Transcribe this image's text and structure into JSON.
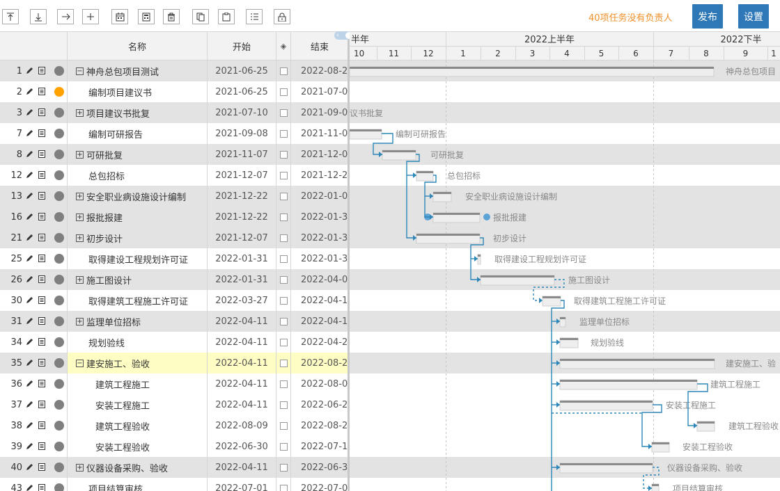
{
  "toolbar": {
    "buttons": [
      {
        "name": "move-top-button",
        "icon": "arrow-top-icon"
      },
      {
        "name": "move-bottom-button",
        "icon": "arrow-bottom-icon"
      },
      {
        "name": "indent-button",
        "icon": "arrow-right-icon"
      },
      {
        "name": "add-button",
        "icon": "plus-icon"
      },
      {
        "name": "calendar-button",
        "icon": "calendar-icon"
      },
      {
        "name": "calculator-button",
        "icon": "calculator-icon"
      },
      {
        "name": "delete-button",
        "icon": "trash-icon"
      },
      {
        "name": "copy-button",
        "icon": "copy-icon"
      },
      {
        "name": "paste-button",
        "icon": "clipboard-icon"
      },
      {
        "name": "checklist-button",
        "icon": "checklist-icon"
      },
      {
        "name": "lock-button",
        "icon": "lock-icon"
      }
    ],
    "warning": "40项任务没有负责人",
    "publish_label": "发布",
    "settings_label": "设置"
  },
  "grid": {
    "headers": {
      "name": "名称",
      "start": "开始",
      "milestone_icon": "◈",
      "end": "结束"
    },
    "rows": [
      {
        "idx": "1",
        "name": "神舟总包项目测试",
        "start": "2021-06-25",
        "end": "2022-08-2",
        "expander": "−",
        "indent": 0,
        "dot": "gray",
        "shade": true
      },
      {
        "idx": "2",
        "name": "编制项目建议书",
        "start": "2021-06-25",
        "end": "2021-07-0",
        "expander": "",
        "indent": 1,
        "dot": "orange",
        "shade": false
      },
      {
        "idx": "3",
        "name": "项目建议书批复",
        "start": "2021-07-10",
        "end": "2021-09-0",
        "expander": "+",
        "indent": 0,
        "dot": "gray",
        "shade": true
      },
      {
        "idx": "7",
        "name": "编制可研报告",
        "start": "2021-09-08",
        "end": "2021-11-0",
        "expander": "",
        "indent": 1,
        "dot": "gray",
        "shade": false
      },
      {
        "idx": "8",
        "name": "可研批复",
        "start": "2021-11-07",
        "end": "2021-12-0",
        "expander": "+",
        "indent": 0,
        "dot": "gray",
        "shade": true
      },
      {
        "idx": "12",
        "name": "总包招标",
        "start": "2021-12-07",
        "end": "2021-12-2",
        "expander": "",
        "indent": 1,
        "dot": "gray",
        "shade": false
      },
      {
        "idx": "13",
        "name": "安全职业病设施设计编制",
        "start": "2021-12-22",
        "end": "2022-01-0",
        "expander": "+",
        "indent": 0,
        "dot": "gray",
        "shade": true
      },
      {
        "idx": "16",
        "name": "报批报建",
        "start": "2021-12-22",
        "end": "2022-01-3",
        "expander": "+",
        "indent": 0,
        "dot": "gray",
        "shade": true
      },
      {
        "idx": "21",
        "name": "初步设计",
        "start": "2021-12-07",
        "end": "2022-01-3",
        "expander": "+",
        "indent": 0,
        "dot": "gray",
        "shade": true
      },
      {
        "idx": "25",
        "name": "取得建设工程规划许可证",
        "start": "2022-01-31",
        "end": "2022-01-3",
        "expander": "",
        "indent": 1,
        "dot": "gray",
        "shade": false
      },
      {
        "idx": "26",
        "name": "施工图设计",
        "start": "2022-01-31",
        "end": "2022-04-0",
        "expander": "+",
        "indent": 0,
        "dot": "gray",
        "shade": true
      },
      {
        "idx": "30",
        "name": "取得建筑工程施工许可证",
        "start": "2022-03-27",
        "end": "2022-04-1",
        "expander": "",
        "indent": 1,
        "dot": "gray",
        "shade": false
      },
      {
        "idx": "31",
        "name": "监理单位招标",
        "start": "2022-04-11",
        "end": "2022-04-1",
        "expander": "+",
        "indent": 0,
        "dot": "gray",
        "shade": true
      },
      {
        "idx": "34",
        "name": "规划验线",
        "start": "2022-04-11",
        "end": "2022-04-2",
        "expander": "",
        "indent": 1,
        "dot": "gray",
        "shade": false
      },
      {
        "idx": "35",
        "name": "建安施工、验收",
        "start": "2022-04-11",
        "end": "2022-08-2",
        "expander": "−",
        "indent": 0,
        "dot": "gray",
        "shade": true,
        "highlight": true
      },
      {
        "idx": "36",
        "name": "建筑工程施工",
        "start": "2022-04-11",
        "end": "2022-08-0",
        "expander": "",
        "indent": 2,
        "dot": "gray",
        "shade": false
      },
      {
        "idx": "37",
        "name": "安装工程施工",
        "start": "2022-04-11",
        "end": "2022-06-2",
        "expander": "",
        "indent": 2,
        "dot": "gray",
        "shade": false
      },
      {
        "idx": "38",
        "name": "建筑工程验收",
        "start": "2022-08-09",
        "end": "2022-08-2",
        "expander": "",
        "indent": 2,
        "dot": "gray",
        "shade": false
      },
      {
        "idx": "39",
        "name": "安装工程验收",
        "start": "2022-06-30",
        "end": "2022-07-1",
        "expander": "",
        "indent": 2,
        "dot": "gray",
        "shade": false
      },
      {
        "idx": "40",
        "name": "仪器设备采购、验收",
        "start": "2022-04-11",
        "end": "2022-06-3",
        "expander": "+",
        "indent": 0,
        "dot": "gray",
        "shade": true
      },
      {
        "idx": "43",
        "name": "项目结算审核",
        "start": "2022-07-01",
        "end": "2022-07-0",
        "expander": "",
        "indent": 1,
        "dot": "gray",
        "shade": false
      }
    ]
  },
  "gantt": {
    "period_headers": [
      {
        "label": "半年"
      },
      {
        "label": "2022上半年"
      },
      {
        "label": "2022下半"
      }
    ],
    "months": [
      "10",
      "11",
      "12",
      "1",
      "2",
      "3",
      "4",
      "5",
      "6",
      "7",
      "8",
      "9",
      "1"
    ],
    "bars": [
      {
        "row": 0,
        "label": "神舟总包项目"
      },
      {
        "row": 2,
        "label": "议书批复"
      },
      {
        "row": 3,
        "label": "编制可研报告"
      },
      {
        "row": 4,
        "label": "可研批复"
      },
      {
        "row": 5,
        "label": "总包招标"
      },
      {
        "row": 6,
        "label": "安全职业病设施设计编制"
      },
      {
        "row": 7,
        "label": "报批报建"
      },
      {
        "row": 8,
        "label": "初步设计"
      },
      {
        "row": 9,
        "label": "取得建设工程规划许可证"
      },
      {
        "row": 10,
        "label": "施工图设计"
      },
      {
        "row": 11,
        "label": "取得建筑工程施工许可证"
      },
      {
        "row": 12,
        "label": "监理单位招标"
      },
      {
        "row": 13,
        "label": "规划验线"
      },
      {
        "row": 14,
        "label": "建安施工、验"
      },
      {
        "row": 15,
        "label": "建筑工程施工"
      },
      {
        "row": 16,
        "label": "安装工程施工"
      },
      {
        "row": 17,
        "label": "建筑工程验收"
      },
      {
        "row": 18,
        "label": "安装工程验收"
      },
      {
        "row": 19,
        "label": "仪器设备采购、验收"
      },
      {
        "row": 20,
        "label": "项目结算审核"
      }
    ]
  }
}
